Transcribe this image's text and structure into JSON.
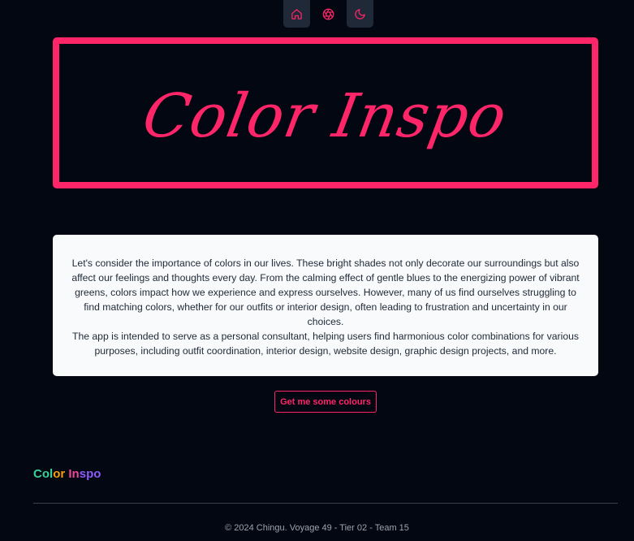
{
  "nav": {
    "items": [
      {
        "icon": "home-icon"
      },
      {
        "icon": "aperture-icon"
      },
      {
        "icon": "moon-icon"
      }
    ]
  },
  "hero": {
    "title": "Color Inspo"
  },
  "intro": {
    "paragraph_1": "Let's consider the importance of colors in our lives. These bright shades not only decorate our surroundings but also affect our feelings and thoughts every day. From the calming effect of gentle blues to the energizing power of vibrant greens, colors impact how we experience and express ourselves. However, many of us find ourselves struggling to find matching colors, whether for our outfits or interior design, often leading to frustration and uncertainty in our choices.",
    "paragraph_2": "The app is intended to serve as a personal consultant, helping users find harmonious color combinations for various purposes, including outfit coordination, interior design, website design, graphic design projects, and more."
  },
  "cta": {
    "label": "Get me some colours"
  },
  "footer": {
    "brand": "Color Inspo",
    "copyright": "© 2024 Chingu. Voyage 49 - Tier 02 - Team 15"
  },
  "colors": {
    "accent": "#ff2569",
    "background": "#030712",
    "card": "#f8fafc",
    "brand_gradient": [
      "#34d399",
      "#f59e0b",
      "#ec4899",
      "#8b5cf6"
    ]
  }
}
